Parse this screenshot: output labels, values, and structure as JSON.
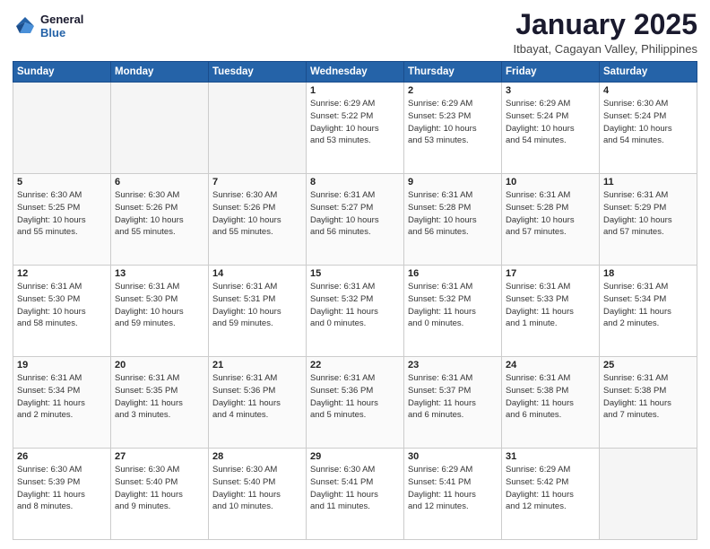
{
  "logo": {
    "line1": "General",
    "line2": "Blue"
  },
  "title": "January 2025",
  "subtitle": "Itbayat, Cagayan Valley, Philippines",
  "weekdays": [
    "Sunday",
    "Monday",
    "Tuesday",
    "Wednesday",
    "Thursday",
    "Friday",
    "Saturday"
  ],
  "weeks": [
    [
      {
        "day": "",
        "info": ""
      },
      {
        "day": "",
        "info": ""
      },
      {
        "day": "",
        "info": ""
      },
      {
        "day": "1",
        "info": "Sunrise: 6:29 AM\nSunset: 5:22 PM\nDaylight: 10 hours\nand 53 minutes."
      },
      {
        "day": "2",
        "info": "Sunrise: 6:29 AM\nSunset: 5:23 PM\nDaylight: 10 hours\nand 53 minutes."
      },
      {
        "day": "3",
        "info": "Sunrise: 6:29 AM\nSunset: 5:24 PM\nDaylight: 10 hours\nand 54 minutes."
      },
      {
        "day": "4",
        "info": "Sunrise: 6:30 AM\nSunset: 5:24 PM\nDaylight: 10 hours\nand 54 minutes."
      }
    ],
    [
      {
        "day": "5",
        "info": "Sunrise: 6:30 AM\nSunset: 5:25 PM\nDaylight: 10 hours\nand 55 minutes."
      },
      {
        "day": "6",
        "info": "Sunrise: 6:30 AM\nSunset: 5:26 PM\nDaylight: 10 hours\nand 55 minutes."
      },
      {
        "day": "7",
        "info": "Sunrise: 6:30 AM\nSunset: 5:26 PM\nDaylight: 10 hours\nand 55 minutes."
      },
      {
        "day": "8",
        "info": "Sunrise: 6:31 AM\nSunset: 5:27 PM\nDaylight: 10 hours\nand 56 minutes."
      },
      {
        "day": "9",
        "info": "Sunrise: 6:31 AM\nSunset: 5:28 PM\nDaylight: 10 hours\nand 56 minutes."
      },
      {
        "day": "10",
        "info": "Sunrise: 6:31 AM\nSunset: 5:28 PM\nDaylight: 10 hours\nand 57 minutes."
      },
      {
        "day": "11",
        "info": "Sunrise: 6:31 AM\nSunset: 5:29 PM\nDaylight: 10 hours\nand 57 minutes."
      }
    ],
    [
      {
        "day": "12",
        "info": "Sunrise: 6:31 AM\nSunset: 5:30 PM\nDaylight: 10 hours\nand 58 minutes."
      },
      {
        "day": "13",
        "info": "Sunrise: 6:31 AM\nSunset: 5:30 PM\nDaylight: 10 hours\nand 59 minutes."
      },
      {
        "day": "14",
        "info": "Sunrise: 6:31 AM\nSunset: 5:31 PM\nDaylight: 10 hours\nand 59 minutes."
      },
      {
        "day": "15",
        "info": "Sunrise: 6:31 AM\nSunset: 5:32 PM\nDaylight: 11 hours\nand 0 minutes."
      },
      {
        "day": "16",
        "info": "Sunrise: 6:31 AM\nSunset: 5:32 PM\nDaylight: 11 hours\nand 0 minutes."
      },
      {
        "day": "17",
        "info": "Sunrise: 6:31 AM\nSunset: 5:33 PM\nDaylight: 11 hours\nand 1 minute."
      },
      {
        "day": "18",
        "info": "Sunrise: 6:31 AM\nSunset: 5:34 PM\nDaylight: 11 hours\nand 2 minutes."
      }
    ],
    [
      {
        "day": "19",
        "info": "Sunrise: 6:31 AM\nSunset: 5:34 PM\nDaylight: 11 hours\nand 2 minutes."
      },
      {
        "day": "20",
        "info": "Sunrise: 6:31 AM\nSunset: 5:35 PM\nDaylight: 11 hours\nand 3 minutes."
      },
      {
        "day": "21",
        "info": "Sunrise: 6:31 AM\nSunset: 5:36 PM\nDaylight: 11 hours\nand 4 minutes."
      },
      {
        "day": "22",
        "info": "Sunrise: 6:31 AM\nSunset: 5:36 PM\nDaylight: 11 hours\nand 5 minutes."
      },
      {
        "day": "23",
        "info": "Sunrise: 6:31 AM\nSunset: 5:37 PM\nDaylight: 11 hours\nand 6 minutes."
      },
      {
        "day": "24",
        "info": "Sunrise: 6:31 AM\nSunset: 5:38 PM\nDaylight: 11 hours\nand 6 minutes."
      },
      {
        "day": "25",
        "info": "Sunrise: 6:31 AM\nSunset: 5:38 PM\nDaylight: 11 hours\nand 7 minutes."
      }
    ],
    [
      {
        "day": "26",
        "info": "Sunrise: 6:30 AM\nSunset: 5:39 PM\nDaylight: 11 hours\nand 8 minutes."
      },
      {
        "day": "27",
        "info": "Sunrise: 6:30 AM\nSunset: 5:40 PM\nDaylight: 11 hours\nand 9 minutes."
      },
      {
        "day": "28",
        "info": "Sunrise: 6:30 AM\nSunset: 5:40 PM\nDaylight: 11 hours\nand 10 minutes."
      },
      {
        "day": "29",
        "info": "Sunrise: 6:30 AM\nSunset: 5:41 PM\nDaylight: 11 hours\nand 11 minutes."
      },
      {
        "day": "30",
        "info": "Sunrise: 6:29 AM\nSunset: 5:41 PM\nDaylight: 11 hours\nand 12 minutes."
      },
      {
        "day": "31",
        "info": "Sunrise: 6:29 AM\nSunset: 5:42 PM\nDaylight: 11 hours\nand 12 minutes."
      },
      {
        "day": "",
        "info": ""
      }
    ]
  ]
}
